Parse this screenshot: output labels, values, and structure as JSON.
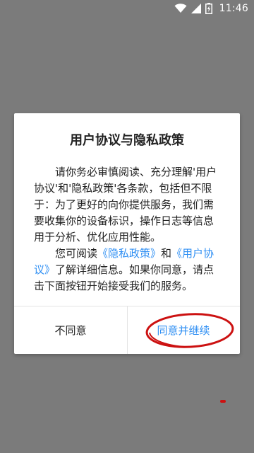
{
  "status_bar": {
    "time": "11:46",
    "icons": [
      "wifi-icon",
      "signal-icon",
      "battery-charging-icon"
    ]
  },
  "dialog": {
    "title": "用户协议与隐私政策",
    "paragraph1": "请你务必审慎阅读、充分理解'用户协议'和'隐私政策'各条款，包括但不限于：为了更好的向你提供服务，我们需要收集你的设备标识，操作日志等信息用于分析、优化应用性能。",
    "paragraph2": {
      "prefix": "您可阅读",
      "privacy_link": "《隐私政策》",
      "and": "和",
      "agreement_link": "《用户协议》",
      "suffix": "了解详细信息。如果你同意，请点击下面按钮开始接受我们的服务。"
    },
    "disagree_button": "不同意",
    "agree_button": "同意并继续"
  },
  "colors": {
    "accent": "#2f8ff3",
    "overlay": "#7b7b7b",
    "annotation": "#cc1111"
  }
}
